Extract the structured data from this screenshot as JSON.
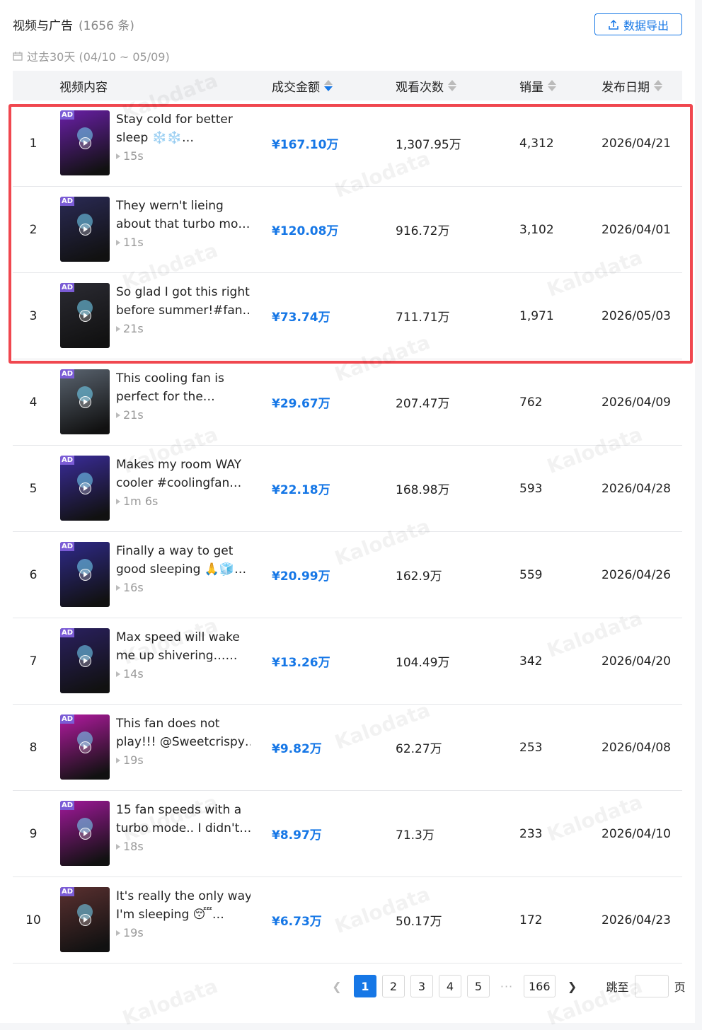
{
  "header": {
    "title": "视频与广告",
    "count": "(1656 条)",
    "export_label": "数据导出",
    "date_range": "过去30天 (04/10 ~ 05/09)"
  },
  "columns": {
    "content": "视频内容",
    "amount": "成交金额",
    "views": "观看次数",
    "sales": "销量",
    "date": "发布日期"
  },
  "colors": {
    "accent": "#1677e6",
    "highlight_border": "#f0474f",
    "ad_badge": "#7b5cd6"
  },
  "rows": [
    {
      "rank": "1",
      "ad": "AD",
      "line1": "Stay cold for better",
      "line2": "sleep ❄️❄️…",
      "duration": "15s",
      "amount": "¥167.10万",
      "views": "1,307.95万",
      "sales": "4,312",
      "date": "2026/04/21",
      "thumb_color": "#6a1fa8"
    },
    {
      "rank": "2",
      "ad": "AD",
      "line1": "They wern't lieing",
      "line2": "about that turbo mo…",
      "duration": "11s",
      "amount": "¥120.08万",
      "views": "916.72万",
      "sales": "3,102",
      "date": "2026/04/01",
      "thumb_color": "#2a2a55"
    },
    {
      "rank": "3",
      "ad": "AD",
      "line1": "So glad I got this right",
      "line2": "before summer!#fan…",
      "duration": "21s",
      "amount": "¥73.74万",
      "views": "711.71万",
      "sales": "1,971",
      "date": "2026/05/03",
      "thumb_color": "#2b2b33"
    },
    {
      "rank": "4",
      "ad": "AD",
      "line1": "This cooling fan is",
      "line2": "perfect for the…",
      "duration": "21s",
      "amount": "¥29.67万",
      "views": "207.47万",
      "sales": "762",
      "date": "2026/04/09",
      "thumb_color": "#5a6470"
    },
    {
      "rank": "5",
      "ad": "AD",
      "line1": "Makes my room WAY",
      "line2": "cooler #coolingfan…",
      "duration": "1m 6s",
      "amount": "¥22.18万",
      "views": "168.98万",
      "sales": "593",
      "date": "2026/04/28",
      "thumb_color": "#3a2c9a"
    },
    {
      "rank": "6",
      "ad": "AD",
      "line1": "Finally a way to get",
      "line2": "good sleeping 🙏🧊…",
      "duration": "16s",
      "amount": "¥20.99万",
      "views": "162.9万",
      "sales": "559",
      "date": "2026/04/26",
      "thumb_color": "#2f2a8a"
    },
    {
      "rank": "7",
      "ad": "AD",
      "line1": "Max speed will wake",
      "line2": "me up shivering……",
      "duration": "14s",
      "amount": "¥13.26万",
      "views": "104.49万",
      "sales": "342",
      "date": "2026/04/20",
      "thumb_color": "#2a2060"
    },
    {
      "rank": "8",
      "ad": "AD",
      "line1": "This fan does not",
      "line2": "play!!! @Sweetcrispy…",
      "duration": "19s",
      "amount": "¥9.82万",
      "views": "62.27万",
      "sales": "253",
      "date": "2026/04/08",
      "thumb_color": "#b21aa0"
    },
    {
      "rank": "9",
      "ad": "AD",
      "line1": "15 fan speeds with a",
      "line2": "turbo mode.. I didn't…",
      "duration": "18s",
      "amount": "¥8.97万",
      "views": "71.3万",
      "sales": "233",
      "date": "2026/04/10",
      "thumb_color": "#a0189a"
    },
    {
      "rank": "10",
      "ad": "AD",
      "line1": "It's really the only way",
      "line2": "I'm sleeping 😴…",
      "duration": "19s",
      "amount": "¥6.73万",
      "views": "50.17万",
      "sales": "172",
      "date": "2026/04/23",
      "thumb_color": "#5a3030"
    }
  ],
  "pagination": {
    "pages": [
      "1",
      "2",
      "3",
      "4",
      "5"
    ],
    "ellipsis": "···",
    "last": "166",
    "current": "1",
    "jump_label": "跳至",
    "page_suffix": "页"
  },
  "watermark": "Kalodata"
}
